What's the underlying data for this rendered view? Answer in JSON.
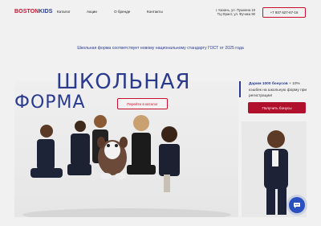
{
  "header": {
    "logo": {
      "part1": "BOSTON",
      "part2": "KIDS"
    },
    "nav": [
      "Каталог",
      "Акции",
      "О бренде",
      "Контакты"
    ],
    "address_line1": "г. Казань, ул. Пушкина 18",
    "address_line2": "ТЦ Франт, ул. Фучика 90",
    "phone": "+7 937 627-67-16"
  },
  "notice": "Школьная форма соответствует новому национальному стандарту ГОСТ от 2025 года",
  "hero": {
    "title_line1": "ШКОЛЬНАЯ",
    "title_line2": "ФОРМА",
    "catalog_button": "Перейти в каталог"
  },
  "bonus": {
    "highlight": "Дарим 1000 бонусов",
    "rest": " + 10% кэшбек на школьную форму при регистрации!",
    "button": "Получить бонусы"
  },
  "colors": {
    "accent_red": "#c8102e",
    "brand_blue": "#2a3a8f",
    "chat_blue": "#2a4fbf"
  },
  "icons": {
    "chat": "chat-bubble-icon"
  }
}
